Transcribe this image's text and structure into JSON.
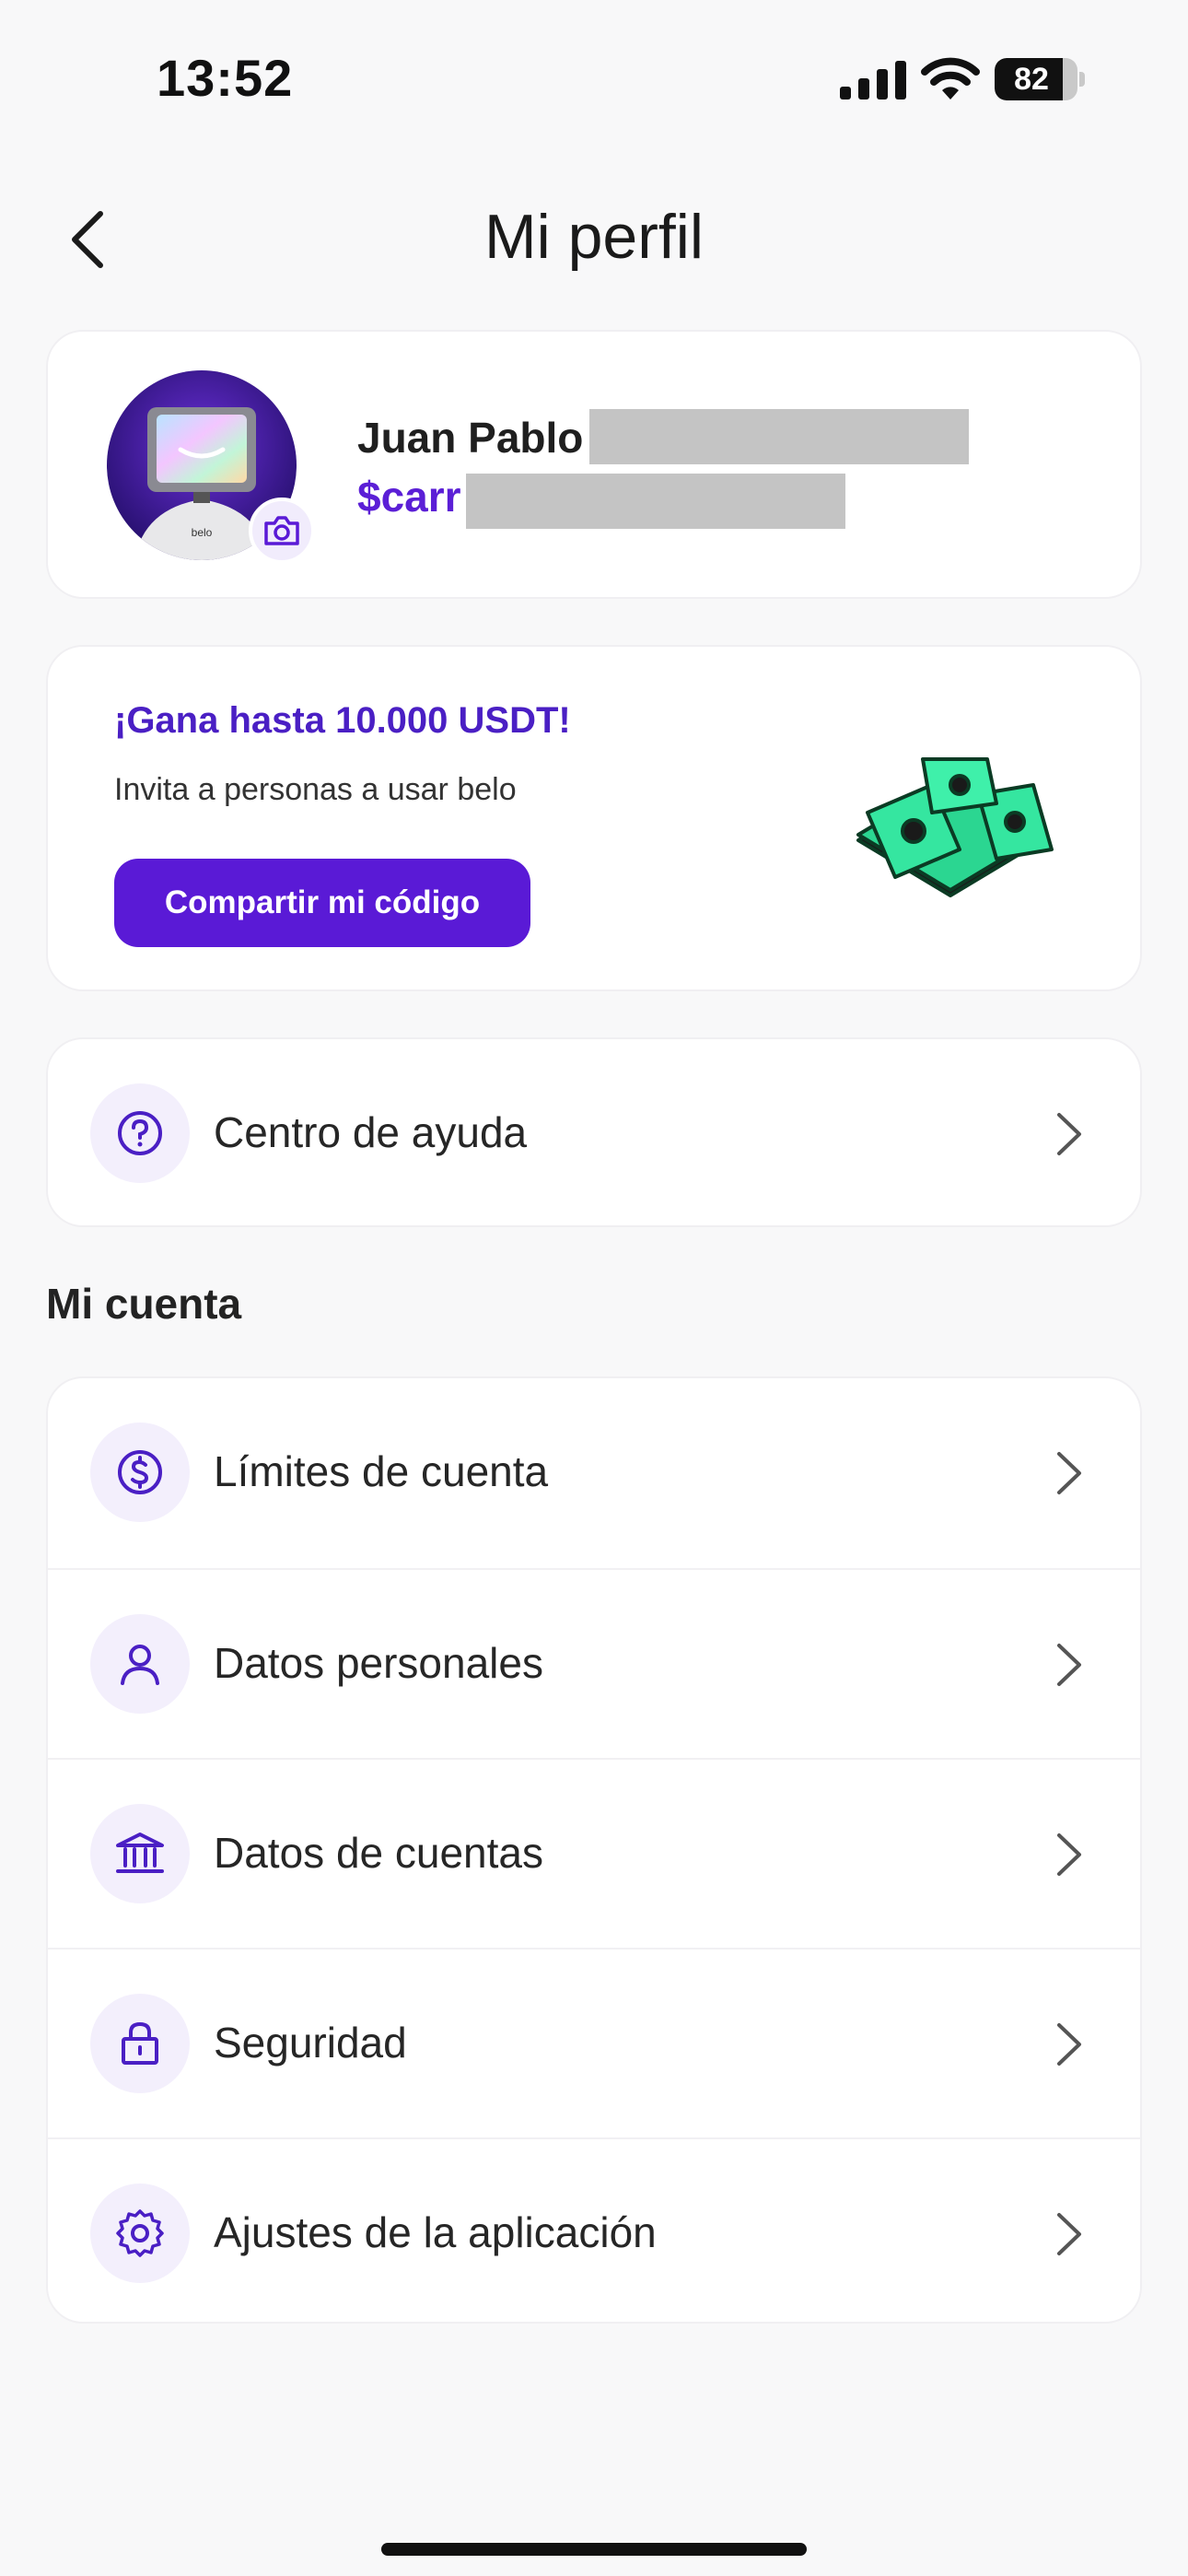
{
  "status_bar": {
    "time": "13:52",
    "battery_level": "82",
    "battery_fraction": 0.82
  },
  "header": {
    "title": "Mi perfil"
  },
  "profile": {
    "name": "Juan Pablo",
    "handle": "$carr"
  },
  "promo": {
    "title": "¡Gana hasta 10.000 USDT!",
    "subtitle": "Invita a personas a usar belo",
    "button_label": "Compartir mi código"
  },
  "help": {
    "label": "Centro de ayuda",
    "icon": "help-circle-icon"
  },
  "account_section": {
    "title": "Mi cuenta",
    "items": [
      {
        "label": "Límites de cuenta",
        "icon": "dollar-circle-icon"
      },
      {
        "label": "Datos personales",
        "icon": "user-icon"
      },
      {
        "label": "Datos de cuentas",
        "icon": "bank-icon"
      },
      {
        "label": "Seguridad",
        "icon": "lock-icon"
      },
      {
        "label": "Ajustes de la aplicación",
        "icon": "gear-icon"
      }
    ]
  },
  "colors": {
    "accent": "#5a1ad6",
    "accent_text": "#4a1fc4",
    "icon_bg": "#f3effc",
    "background": "#f8f8f9"
  }
}
